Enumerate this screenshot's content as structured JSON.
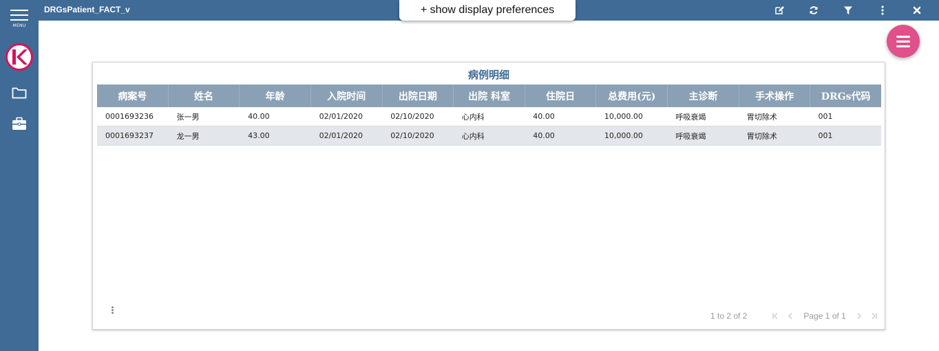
{
  "sidebar": {
    "menu_label": "MENU",
    "logo_letter": "K",
    "logo_color": "#d4145a",
    "icons": [
      "folder-icon",
      "briefcase-icon"
    ]
  },
  "topbar": {
    "title": "DRGsPatient_FACT_v",
    "prefs_button": "+ show display preferences",
    "icons": [
      "edit-icon",
      "refresh-icon",
      "filter-icon",
      "more-vertical-icon",
      "close-icon"
    ]
  },
  "colors": {
    "accent": "#3f6b96",
    "fab": "#e0508a",
    "header": "#8aa0b4",
    "alt_row": "#e3e6ea"
  },
  "panel": {
    "title": "病例明细",
    "columns": [
      "病案号",
      "姓名",
      "年龄",
      "入院时间",
      "出院日期",
      "出院 科室",
      "住院日",
      "总费用(元)",
      "主诊断",
      "手术操作",
      "DRGs代码"
    ],
    "rows": [
      [
        "0001693236",
        "张一男",
        "40.00",
        "02/01/2020",
        "02/10/2020",
        "心内科",
        "40.00",
        "10,000.00",
        "呼吸衰竭",
        "胃切除术",
        "001"
      ],
      [
        "0001693237",
        "龙一男",
        "43.00",
        "02/01/2020",
        "02/10/2020",
        "心内科",
        "40.00",
        "10,000.00",
        "呼吸衰竭",
        "胃切除术",
        "001"
      ]
    ],
    "pager": {
      "summary": "1 to 2 of 2",
      "page_info": "Page 1 of 1"
    }
  }
}
